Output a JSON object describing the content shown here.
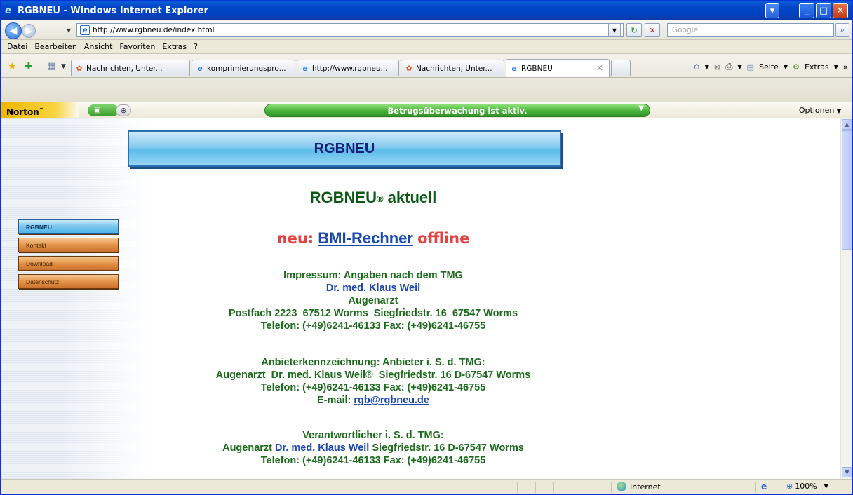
{
  "window": {
    "title": "RGBNEU - Windows Internet Explorer"
  },
  "address": {
    "url": "http://www.rgbneu.de/index.html",
    "search_placeholder": "Google"
  },
  "menu": [
    "Datei",
    "Bearbeiten",
    "Ansicht",
    "Favoriten",
    "Extras",
    "?"
  ],
  "tabs": [
    {
      "label": "Nachrichten, Unter...",
      "icon": "msn-icon"
    },
    {
      "label": "komprimierungspro...",
      "icon": "ie-icon"
    },
    {
      "label": "http://www.rgbneu...",
      "icon": "ie-icon"
    },
    {
      "label": "Nachrichten, Unter...",
      "icon": "msn-icon"
    },
    {
      "label": "RGBNEU",
      "icon": "ie-icon",
      "active": true
    }
  ],
  "commandbar": {
    "page": "Seite",
    "tools": "Extras"
  },
  "norton": {
    "logo": "Norton",
    "status": "Betrugsüberwachung ist aktiv.",
    "options": "Optionen"
  },
  "page": {
    "banner": "RGBNEU",
    "nav": [
      "RGBNEU",
      "Kontakt",
      "Download",
      "Datenschutz"
    ],
    "headline": "RGBNEU",
    "headline_reg": "®",
    "headline_suffix": " aktuell",
    "bmi_prefix": "neu:",
    "bmi_link": "BMI-Rechner",
    "bmi_suffix": "offline",
    "impressum": {
      "title": "Impressum: Angaben nach dem TMG",
      "name_link": "Dr. med. Klaus Weil",
      "role": "Augenarzt",
      "address": "Postfach 2223  67512 Worms  Siegfriedstr. 16  67547 Worms",
      "phone": "Telefon: (+49)6241-46133 Fax: (+49)6241-46755"
    },
    "anbieter": {
      "title": "Anbieterkennzeichnung: Anbieter i. S. d. TMG:",
      "line": "Augenarzt  Dr. med. Klaus Weil®  Siegfriedstr. 16 D-67547 Worms",
      "phone": "Telefon: (+49)6241-46133 Fax: (+49)6241-46755",
      "email_label": "E-mail:",
      "email": "rgb@rgbneu.de"
    },
    "verantwortlicher": {
      "title": "Verantwortlicher i. S. d. TMG:",
      "prefix": "Augenarzt",
      "name_link": "Dr. med. Klaus Weil",
      "suffix": "Siegfriedstr. 16 D-67547 Worms",
      "phone": "Telefon: (+49)6241-46133 Fax: (+49)6241-46755"
    }
  },
  "status": {
    "zone": "Internet",
    "zoom": "100%"
  }
}
